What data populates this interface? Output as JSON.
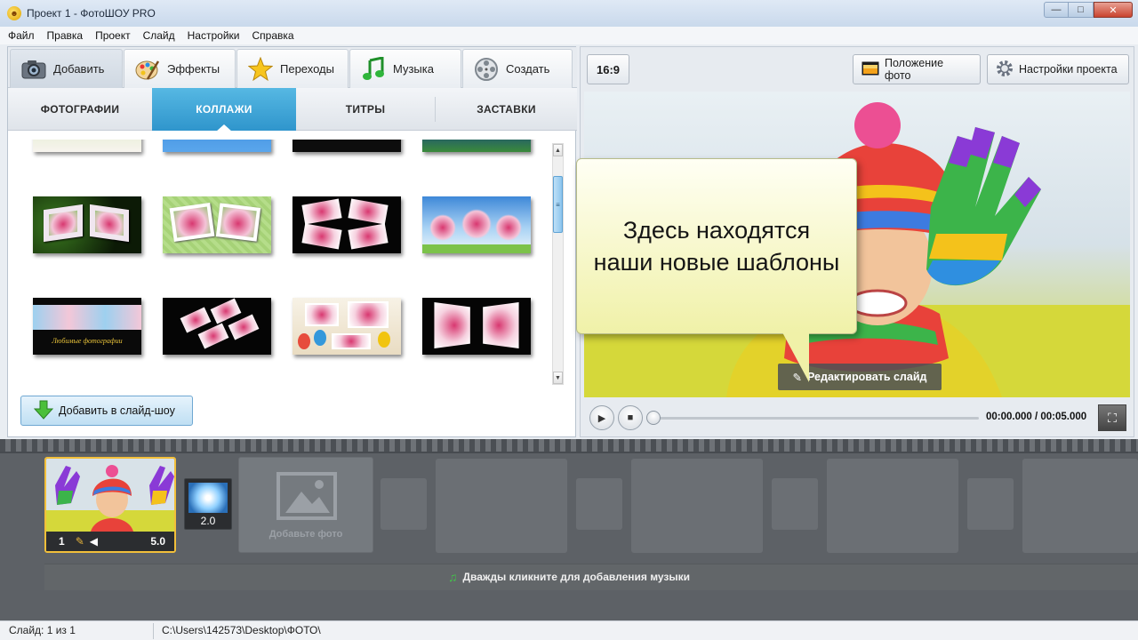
{
  "window": {
    "title": "Проект 1 - ФотоШОУ PRO",
    "controls": [
      "—",
      "□",
      "✕"
    ]
  },
  "menu": [
    "Файл",
    "Правка",
    "Проект",
    "Слайд",
    "Настройки",
    "Справка"
  ],
  "main_tabs": [
    {
      "label": "Добавить",
      "icon": "camera-icon",
      "active": true
    },
    {
      "label": "Эффекты",
      "icon": "palette-icon"
    },
    {
      "label": "Переходы",
      "icon": "star-icon"
    },
    {
      "label": "Музыка",
      "icon": "music-note-icon"
    },
    {
      "label": "Создать",
      "icon": "film-reel-icon"
    }
  ],
  "sub_tabs": [
    {
      "label": "ФОТОГРАФИИ"
    },
    {
      "label": "КОЛЛАЖИ",
      "active": true
    },
    {
      "label": "ТИТРЫ"
    },
    {
      "label": "ЗАСТАВКИ"
    }
  ],
  "gallery_caption": "Любимые фотографии",
  "add_to_slideshow": "Добавить в слайд-шоу",
  "toolbar": {
    "ratio": "16:9",
    "photo_position": "Положение фото",
    "project_settings": "Настройки проекта"
  },
  "callout": "Здесь находятся наши новые шаблоны",
  "edit_slide": "Редактировать слайд",
  "player": {
    "time": "00:00.000 / 00:05.000"
  },
  "timeline": {
    "slide_number": "1",
    "slide_duration": "5.0",
    "transition_duration": "2.0",
    "add_photo": "Добавьте фото",
    "music_hint": "Дважды кликните для добавления музыки"
  },
  "status": {
    "slide": "Слайд: 1 из 1",
    "path": "C:\\Users\\142573\\Desktop\\ФОТО\\"
  },
  "colors": {
    "accent_tab": "#2f95cc",
    "timeline_bg": "#5d6166",
    "selected_slide_border": "#f2bf3a",
    "callout_bg": "#f0f1a8"
  }
}
